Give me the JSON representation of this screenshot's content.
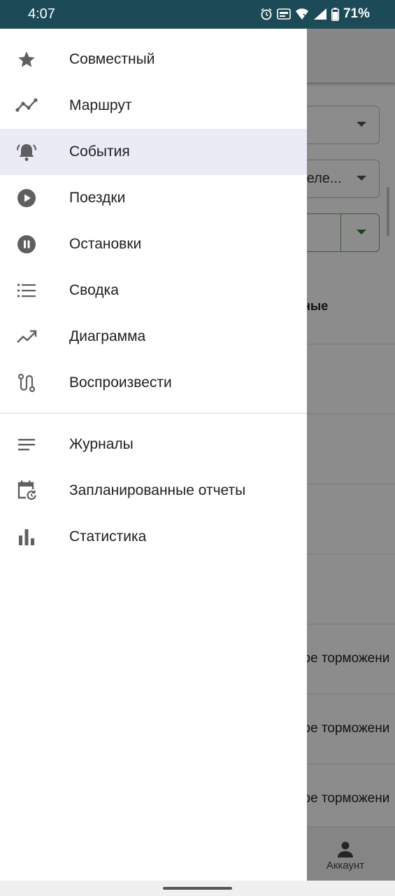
{
  "status_bar": {
    "time": "4:07",
    "battery": "71%",
    "icons": [
      "alarm-icon",
      "auto-icon",
      "wifi-icon",
      "signal-icon",
      "battery-icon"
    ]
  },
  "background": {
    "select_2_text": "деле...",
    "table_header": "ные",
    "rows": [
      "",
      "",
      "",
      "",
      "кое торможени",
      "кое торможени",
      "кое торможени"
    ],
    "bottom_nav": {
      "account_label": "Аккаунт"
    }
  },
  "drawer": {
    "active_index": 2,
    "main_items": [
      {
        "label": "Совместный",
        "icon": "star-icon"
      },
      {
        "label": "Маршрут",
        "icon": "route-line-icon"
      },
      {
        "label": "События",
        "icon": "bell-alert-icon"
      },
      {
        "label": "Поездки",
        "icon": "play-circle-icon"
      },
      {
        "label": "Остановки",
        "icon": "pause-circle-icon"
      },
      {
        "label": "Сводка",
        "icon": "list-icon"
      },
      {
        "label": "Диаграмма",
        "icon": "trending-up-icon"
      },
      {
        "label": "Воспроизвести",
        "icon": "replay-path-icon"
      }
    ],
    "secondary_items": [
      {
        "label": "Журналы",
        "icon": "notes-icon"
      },
      {
        "label": "Запланированные отчеты",
        "icon": "calendar-schedule-icon"
      },
      {
        "label": "Статистика",
        "icon": "bar-chart-icon"
      }
    ]
  },
  "colors": {
    "status_bar": "#1c4a57",
    "active_item_bg": "#eaebf5",
    "icon": "#5f5f5f"
  }
}
